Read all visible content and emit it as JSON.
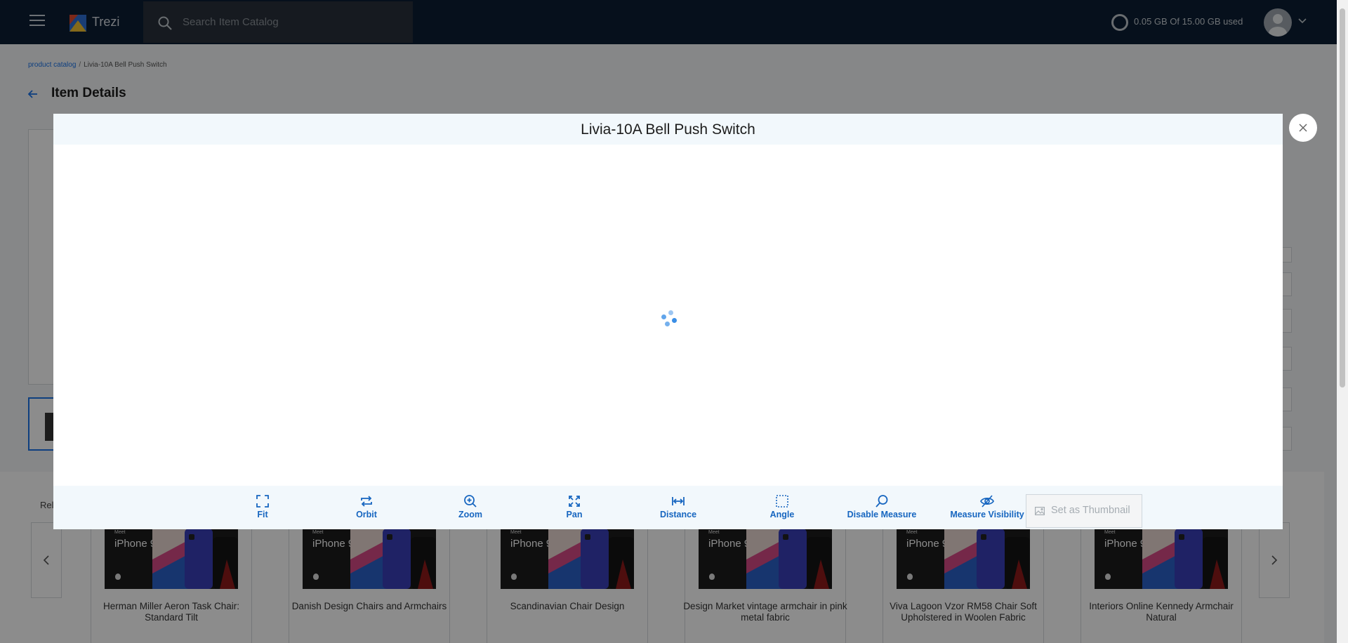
{
  "topbar": {
    "app_name": "Trezi",
    "search_placeholder": "Search Item Catalog",
    "storage_text": "0.05 GB Of 15.00 GB used"
  },
  "breadcrumb": {
    "root": "product catalog",
    "separator": "/",
    "current": "Livia-10A Bell Push Switch"
  },
  "page": {
    "title": "Item Details"
  },
  "related": {
    "label": "Rel",
    "ad_meet": "Meet",
    "ad_title": "iPhone 9",
    "items": [
      {
        "name": "Herman Miller Aeron Task Chair: Standard Tilt"
      },
      {
        "name": "Danish Design Chairs and Armchairs"
      },
      {
        "name": "Scandinavian Chair Design"
      },
      {
        "name": "Design Market vintage armchair in pink metal fabric"
      },
      {
        "name": "Viva Lagoon Vzor RM58 Chair Soft Upholstered in Woolen Fabric"
      },
      {
        "name": "Interiors Online Kennedy Armchair Natural"
      }
    ]
  },
  "modal": {
    "title": "Livia-10A Bell Push Switch",
    "tools": [
      {
        "label": "Fit",
        "icon": "fit-icon"
      },
      {
        "label": "Orbit",
        "icon": "orbit-icon"
      },
      {
        "label": "Zoom",
        "icon": "zoom-icon"
      },
      {
        "label": "Pan",
        "icon": "pan-icon"
      },
      {
        "label": "Distance",
        "icon": "distance-icon"
      },
      {
        "label": "Angle",
        "icon": "angle-icon"
      },
      {
        "label": "Disable Measure",
        "icon": "measure-icon"
      },
      {
        "label": "Measure Visibility",
        "icon": "eye-slash-icon"
      }
    ],
    "thumbnail_button": "Set as Thumbnail"
  },
  "colors": {
    "topbar_bg": "#0b1e33",
    "accent": "#1766c0",
    "modal_header_bg": "#f2f8fc"
  }
}
